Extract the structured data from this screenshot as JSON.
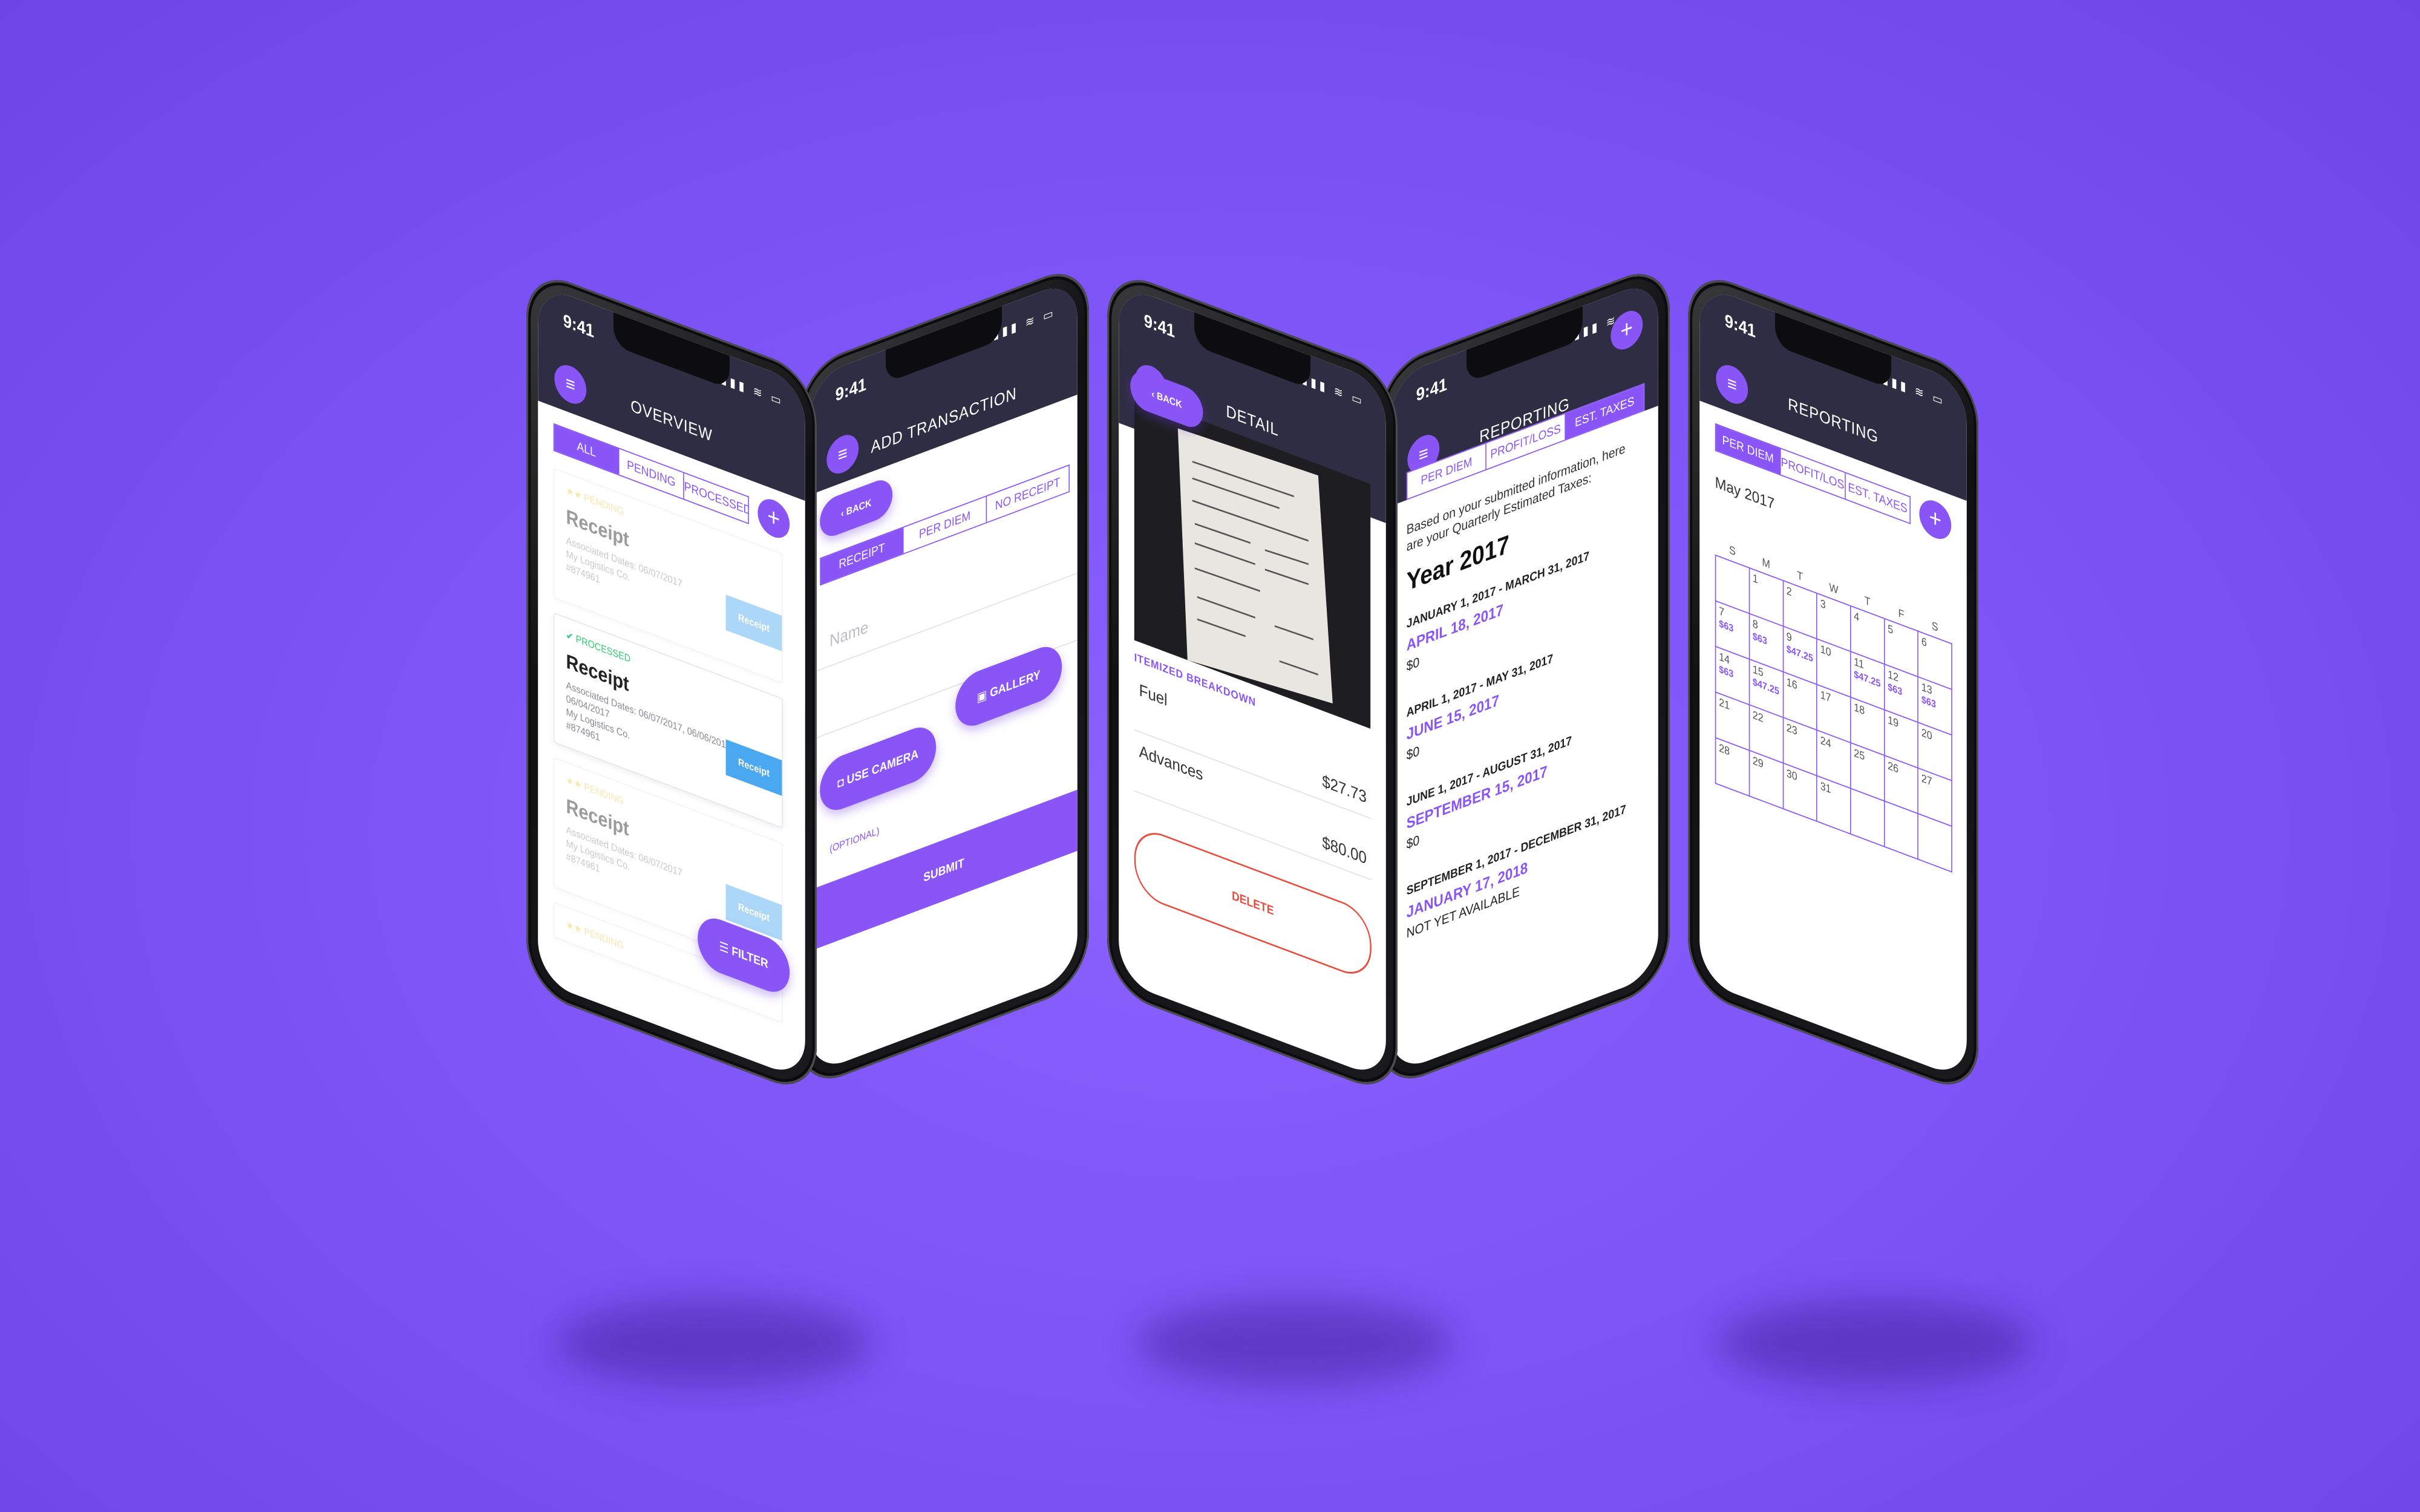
{
  "colors": {
    "background": "#7b52f4",
    "accent": "#8a55f7",
    "header": "#2f2d44",
    "receipt_button": "#4aa8f0",
    "pending": "#f2c94c",
    "processed": "#2ecc71",
    "delete": "#e74c3c"
  },
  "status_bar": {
    "time": "9:41",
    "icons": "signal-icon wifi-icon battery-icon"
  },
  "overview": {
    "title": "OVERVIEW",
    "tabs": [
      "ALL",
      "PENDING",
      "PROCESSED"
    ],
    "cards": [
      {
        "status": "★★ PENDING",
        "title": "Receipt",
        "meta": "Associated Dates: 06/07/2017\nMy Logistics Co.\n#874961",
        "button": "Receipt"
      },
      {
        "status": "✔ PROCESSED",
        "title": "Receipt",
        "meta": "Associated Dates: 06/07/2017, 06/06/2017, 06/04/2017\nMy Logistics Co.\n#874961",
        "button": "Receipt"
      },
      {
        "status": "★★ PENDING",
        "title": "Receipt",
        "meta": "Associated Dates: 06/07/2017\nMy Logistics Co.\n#874961",
        "button": "Receipt"
      },
      {
        "status": "★★ PENDING",
        "title": "",
        "meta": "",
        "button": ""
      }
    ],
    "filter": "FILTER"
  },
  "add_transaction": {
    "title": "ADD TRANSACTION",
    "back": "BACK",
    "tabs": [
      "RECEIPT",
      "PER DIEM",
      "NO RECEIPT"
    ],
    "name_placeholder": "Name",
    "use_camera": "USE CAMERA",
    "gallery": "GALLERY",
    "optional": "(OPTIONAL)",
    "submit": "SUBMIT"
  },
  "detail": {
    "title": "DETAIL",
    "back": "BACK",
    "section": "ITEMIZED BREAKDOWN",
    "items": [
      {
        "label": "Fuel",
        "amount": "$27.73"
      },
      {
        "label": "Advances",
        "amount": "$80.00"
      }
    ],
    "delete": "DELETE"
  },
  "reporting_taxes": {
    "title": "REPORTING",
    "tabs": [
      "PER DIEM",
      "PROFIT/LOSS",
      "EST. TAXES"
    ],
    "intro": "Based on your submitted information, here are your Quarterly Estimated Taxes:",
    "year": "Year 2017",
    "quarters": [
      {
        "range": "JANUARY 1, 2017 - MARCH 31, 2017",
        "due": "APRIL 18, 2017",
        "amount": "$0"
      },
      {
        "range": "APRIL 1, 2017 - MAY 31, 2017",
        "due": "JUNE 15, 2017",
        "amount": "$0"
      },
      {
        "range": "JUNE 1, 2017 - AUGUST 31, 2017",
        "due": "SEPTEMBER 15, 2017",
        "amount": "$0"
      },
      {
        "range": "SEPTEMBER 1, 2017 - DECEMBER 31, 2017",
        "due": "JANUARY 17, 2018",
        "amount": "NOT YET AVAILABLE"
      }
    ]
  },
  "reporting_perdiem": {
    "title": "REPORTING",
    "tabs": [
      "PER DIEM",
      "PROFIT/LOSS",
      "EST. TAXES"
    ],
    "month": "May 2017",
    "weekdays": [
      "S",
      "M",
      "T",
      "W",
      "T",
      "F",
      "S"
    ],
    "weeks": [
      [
        {
          "d": ""
        },
        {
          "d": "1"
        },
        {
          "d": "2"
        },
        {
          "d": "3"
        },
        {
          "d": "4"
        },
        {
          "d": "5"
        },
        {
          "d": "6"
        }
      ],
      [
        {
          "d": "7",
          "a": "$63"
        },
        {
          "d": "8",
          "a": "$63"
        },
        {
          "d": "9",
          "a": "$47.25"
        },
        {
          "d": "10"
        },
        {
          "d": "11",
          "a": "$47.25"
        },
        {
          "d": "12",
          "a": "$63"
        },
        {
          "d": "13",
          "a": "$63"
        }
      ],
      [
        {
          "d": "14",
          "a": "$63"
        },
        {
          "d": "15",
          "a": "$47.25"
        },
        {
          "d": "16"
        },
        {
          "d": "17"
        },
        {
          "d": "18"
        },
        {
          "d": "19"
        },
        {
          "d": "20"
        }
      ],
      [
        {
          "d": "21"
        },
        {
          "d": "22"
        },
        {
          "d": "23"
        },
        {
          "d": "24"
        },
        {
          "d": "25"
        },
        {
          "d": "26"
        },
        {
          "d": "27"
        }
      ],
      [
        {
          "d": "28"
        },
        {
          "d": "29"
        },
        {
          "d": "30"
        },
        {
          "d": "31"
        },
        {
          "d": ""
        },
        {
          "d": ""
        },
        {
          "d": ""
        }
      ]
    ]
  }
}
